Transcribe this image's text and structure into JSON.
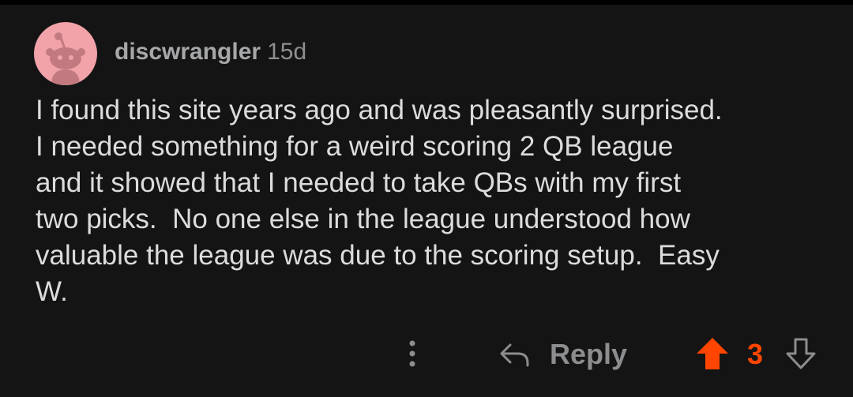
{
  "comment": {
    "username": "discwrangler",
    "age": "15d",
    "body_lines": [
      "I found this site years ago and was pleasantly surprised.",
      "I needed something for a weird scoring 2 QB league",
      "and it showed that I needed to take QBs with my first",
      "two picks.  No one else in the league understood how",
      "valuable the league was due to the scoring setup.  Easy",
      "W."
    ]
  },
  "actions": {
    "more_icon": "more-vertical-icon",
    "reply_icon": "reply-arrow-icon",
    "reply_label": "Reply",
    "upvote_icon": "upvote-arrow-icon",
    "score": "3",
    "downvote_icon": "downvote-arrow-icon"
  },
  "colors": {
    "background": "#141414",
    "avatar": "#f1a3a9",
    "accent_upvoted": "#ff4500",
    "muted_text": "#8c8d8f"
  }
}
